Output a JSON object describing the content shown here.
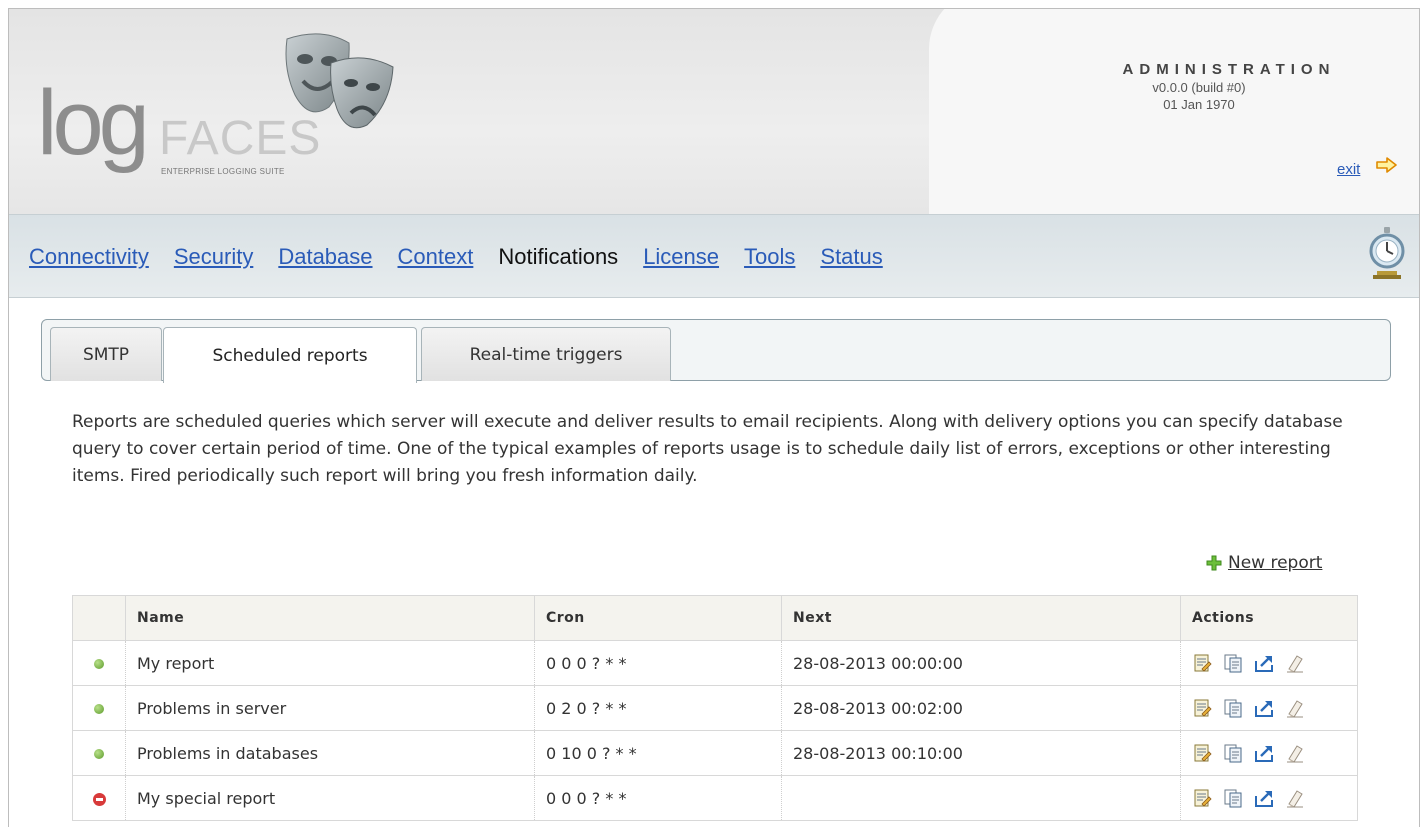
{
  "brand": {
    "logo_main": "log",
    "logo_accent": "FACES",
    "logo_tagline": "ENTERPRISE LOGGING SUITE"
  },
  "header": {
    "title": "ADMINISTRATION",
    "version": "v0.0.0 (build #0)",
    "date": "01 Jan 1970",
    "exit_label": "exit"
  },
  "nav": {
    "items": [
      {
        "label": "Connectivity",
        "active": false
      },
      {
        "label": "Security",
        "active": false
      },
      {
        "label": "Database",
        "active": false
      },
      {
        "label": "Context",
        "active": false
      },
      {
        "label": "Notifications",
        "active": true
      },
      {
        "label": "License",
        "active": false
      },
      {
        "label": "Tools",
        "active": false
      },
      {
        "label": "Status",
        "active": false
      }
    ]
  },
  "tabs": [
    {
      "label": "SMTP",
      "active": false
    },
    {
      "label": "Scheduled reports",
      "active": true
    },
    {
      "label": "Real-time triggers",
      "active": false
    }
  ],
  "description": "Reports are scheduled queries which server will execute and deliver results to email recipients. Along with delivery options you can specify database query to cover certain period of time. One of the typical examples of reports usage is to schedule daily list of errors, exceptions or other interesting items. Fired periodically such report will bring you fresh information daily.",
  "new_report_label": "New report",
  "table": {
    "columns": [
      "",
      "Name",
      "Cron",
      "Next",
      "Actions"
    ],
    "rows": [
      {
        "status": "enabled",
        "name": "My report",
        "cron": "0 0 0 ? * *",
        "next": "28-08-2013 00:00:00"
      },
      {
        "status": "enabled",
        "name": "Problems in server",
        "cron": "0 2 0 ? * *",
        "next": "28-08-2013 00:02:00"
      },
      {
        "status": "enabled",
        "name": "Problems in databases",
        "cron": "0 10 0 ? * *",
        "next": "28-08-2013 00:10:00"
      },
      {
        "status": "disabled",
        "name": "My special report",
        "cron": "0 0 0 ? * *",
        "next": ""
      }
    ]
  },
  "colors": {
    "link": "#2a5bb8",
    "enabled": "#5c9a2a",
    "disabled": "#d83a3a"
  },
  "icons": {
    "row_actions": [
      "edit-report-icon",
      "copy-report-icon",
      "run-report-icon",
      "delete-report-icon"
    ],
    "new_report": "plus-icon",
    "exit": "exit-arrow-icon",
    "status": "stopwatch-icon"
  }
}
